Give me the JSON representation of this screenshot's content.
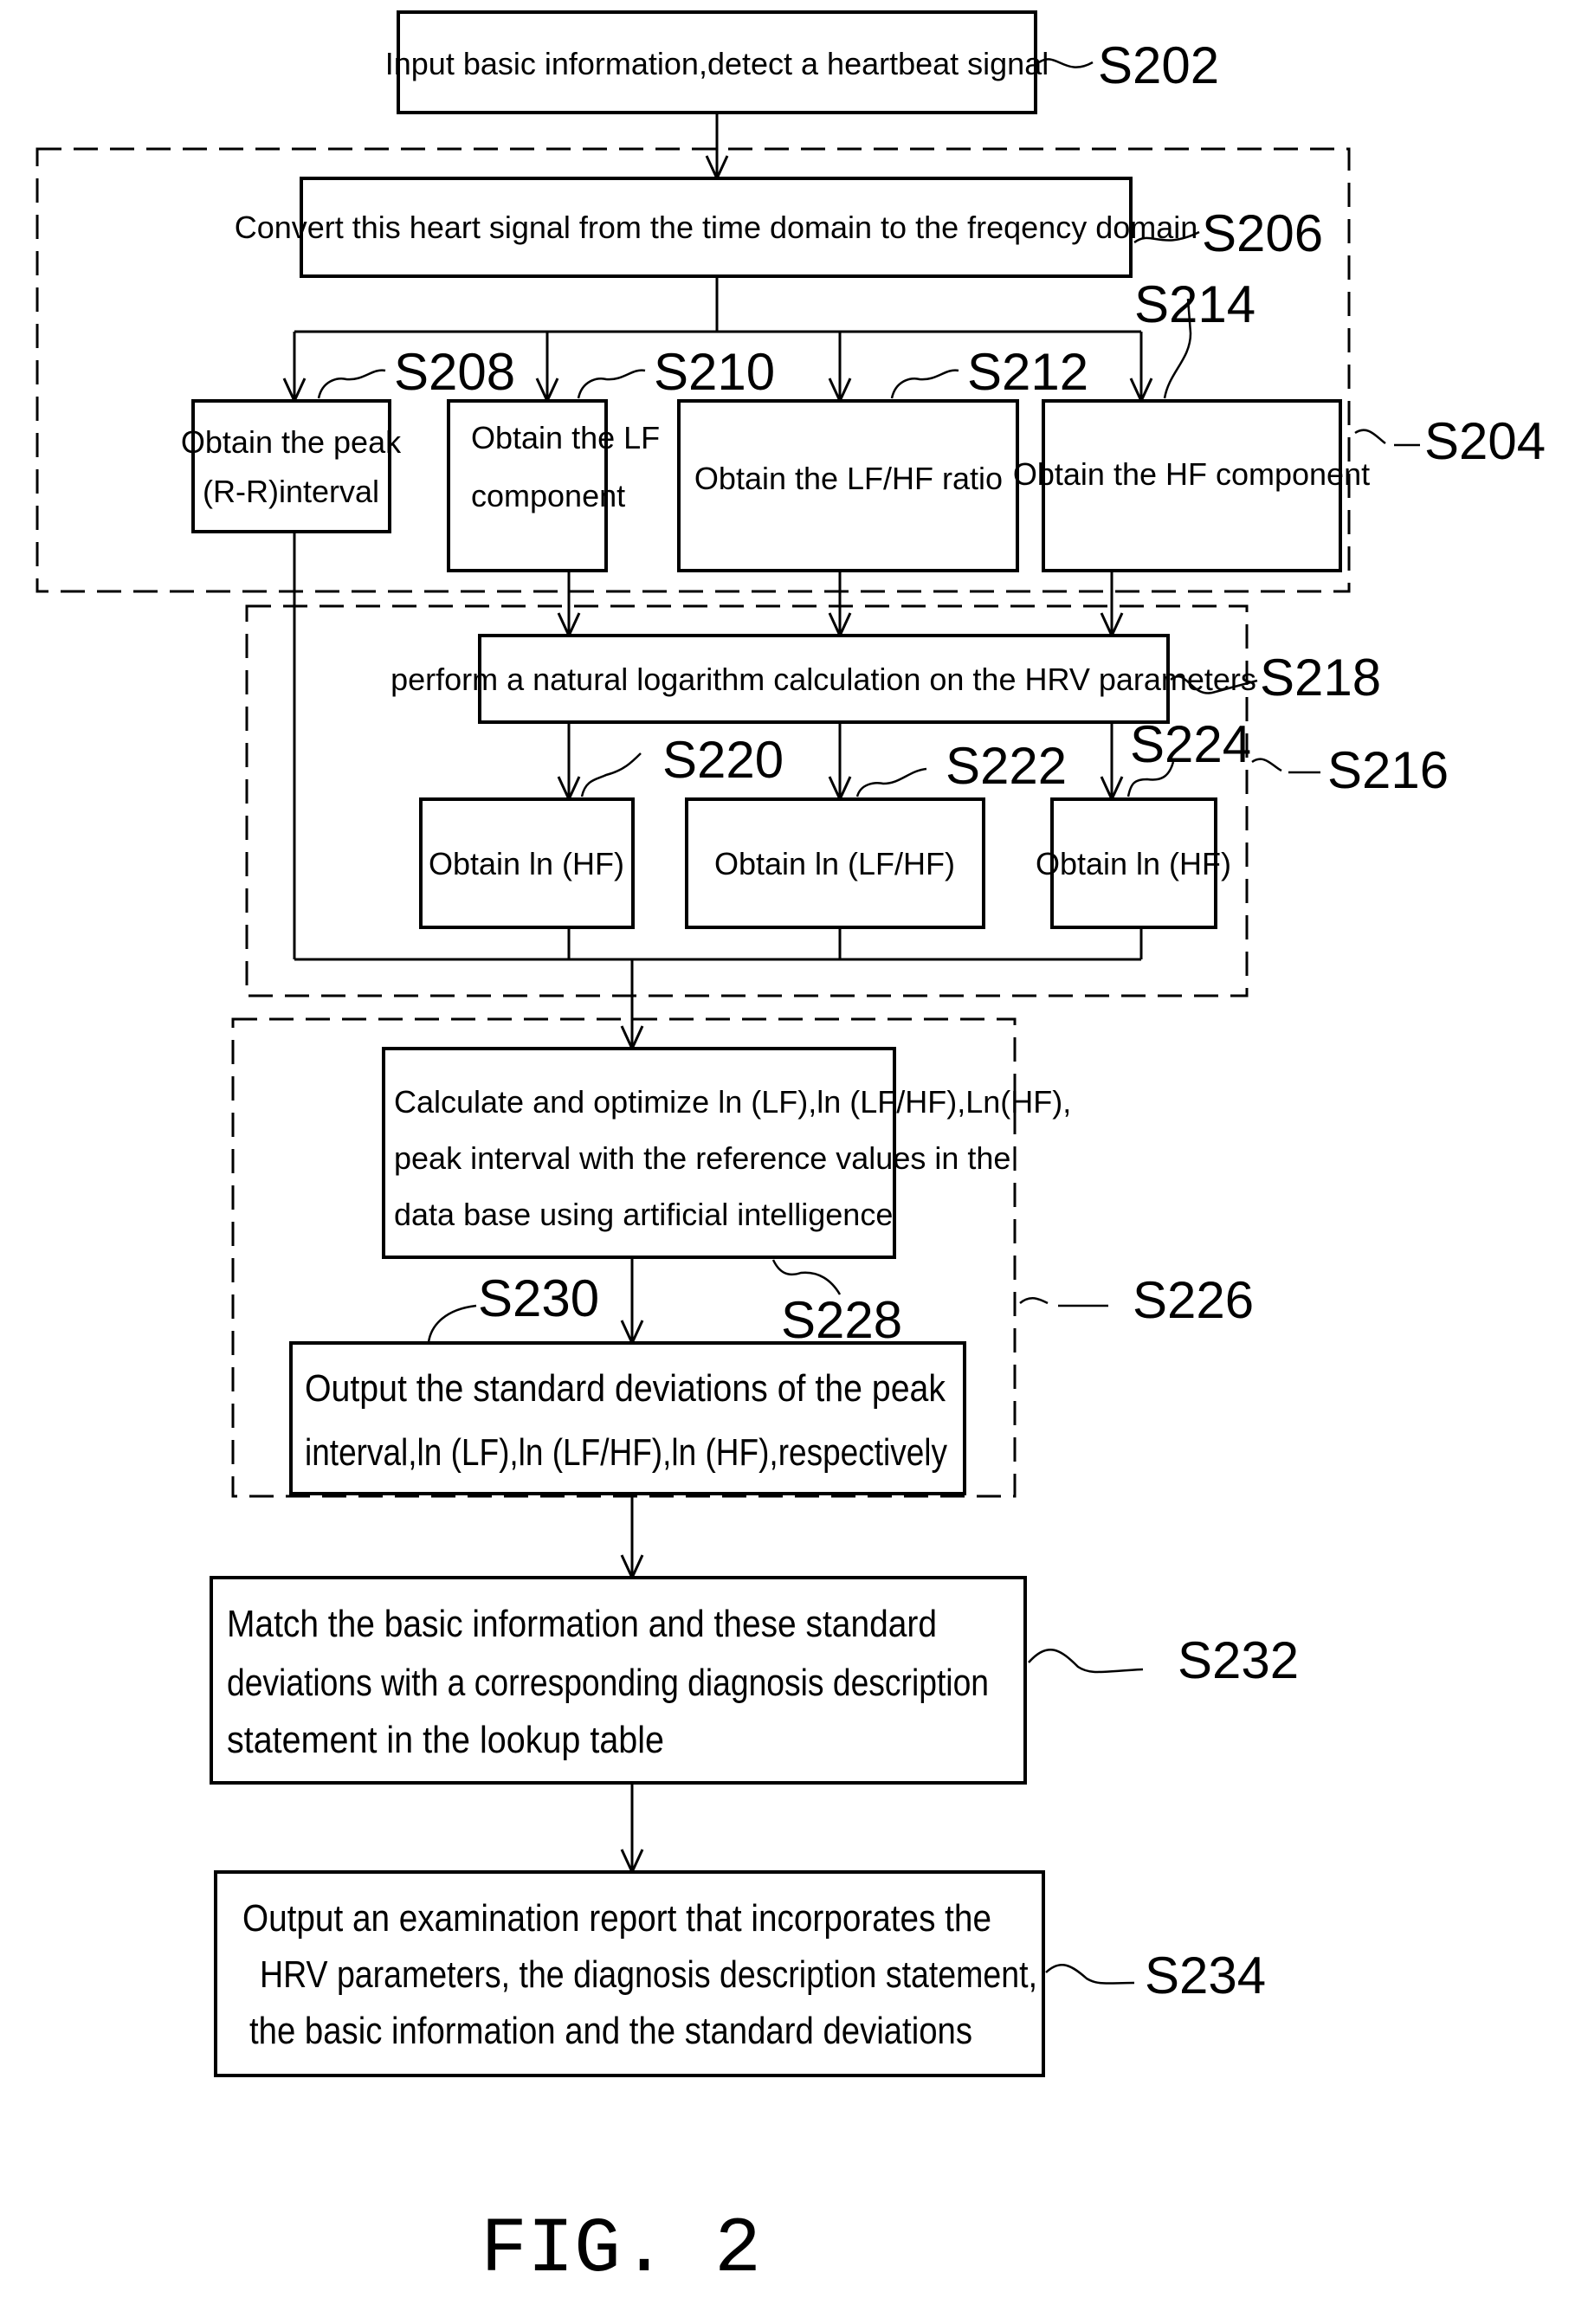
{
  "figure": {
    "caption": "FIG. 2"
  },
  "steps": {
    "s202": {
      "label": "S202",
      "text": [
        "Input basic information,detect a heartbeat signal"
      ]
    },
    "s204": {
      "label": "S204"
    },
    "s206": {
      "label": "S206",
      "text": [
        "Convert this heart signal from the time domain to the freqency domain"
      ]
    },
    "s208": {
      "label": "S208",
      "text": [
        "Obtain the peak",
        "(R-R)interval"
      ]
    },
    "s210": {
      "label": "S210",
      "text": [
        "Obtain the LF",
        "component"
      ]
    },
    "s212": {
      "label": "S212",
      "text": [
        "Obtain the LF/HF ratio"
      ]
    },
    "s214": {
      "label": "S214",
      "text": [
        "Obtain the HF component"
      ]
    },
    "s216": {
      "label": "S216"
    },
    "s218": {
      "label": "S218",
      "text": [
        "perform a natural logarithm calculation on the HRV parameters"
      ]
    },
    "s220": {
      "label": "S220",
      "text": [
        "Obtain ln (HF)"
      ]
    },
    "s222": {
      "label": "S222",
      "text": [
        "Obtain ln (LF/HF)"
      ]
    },
    "s224": {
      "label": "S224",
      "text": [
        "Obtain ln (HF)"
      ]
    },
    "s226": {
      "label": "S226"
    },
    "s228": {
      "label": "S228",
      "text": [
        "Calculate and optimize ln (LF),ln (LF/HF),Ln(HF),",
        "peak interval with the reference values in the",
        "data base using artificial intelligence"
      ]
    },
    "s230": {
      "label": "S230",
      "text": [
        "Output the standard deviations of the peak",
        "interval,ln (LF),ln (LF/HF),ln (HF),respectively"
      ]
    },
    "s232": {
      "label": "S232",
      "text": [
        "Match the basic information and these standard",
        "deviations with a corresponding diagnosis description",
        "statement in the lookup table"
      ]
    },
    "s234": {
      "label": "S234",
      "text": [
        "Output an examination report that incorporates the",
        "HRV parameters, the diagnosis description statement,",
        "the basic information and the standard deviations"
      ]
    }
  }
}
